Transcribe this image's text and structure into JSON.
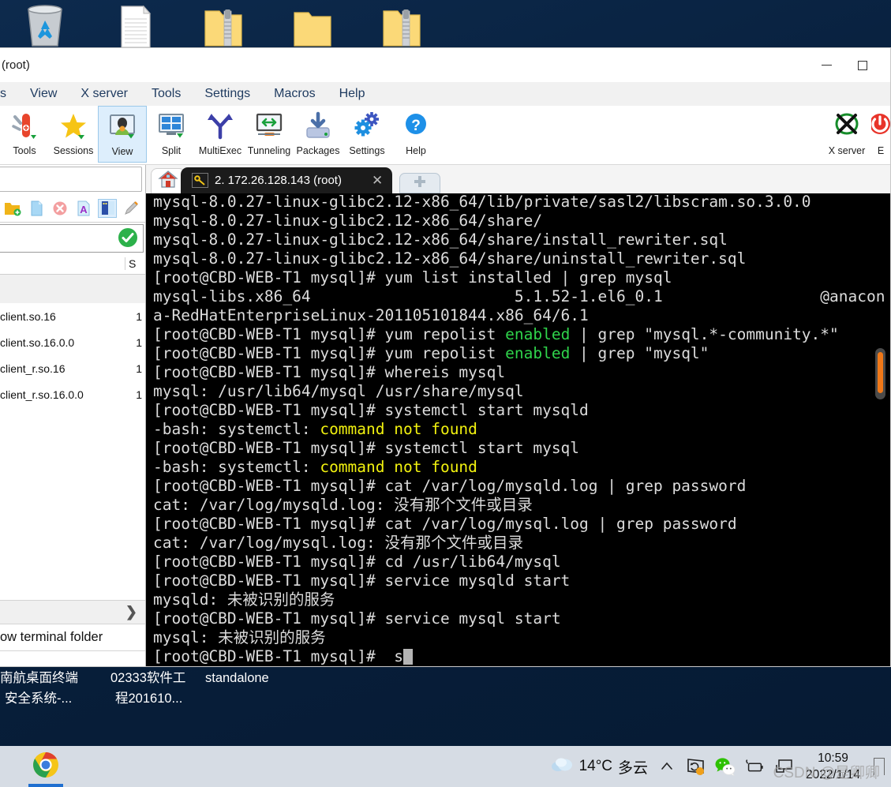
{
  "desktop": {
    "icons_top": [
      {
        "name": "recycle-bin"
      },
      {
        "name": "text-document"
      },
      {
        "name": "zip-folder-1"
      },
      {
        "name": "plain-folder"
      },
      {
        "name": "zip-folder-2"
      }
    ],
    "icon_labels": [
      {
        "line1": "南航桌面终端",
        "line2": "安全系统-..."
      },
      {
        "line1": "02333软件工",
        "line2": "程201610..."
      },
      {
        "line1": "standalone",
        "line2": ""
      }
    ]
  },
  "window": {
    "title": "(root)",
    "minimize_icon": "minimize-icon",
    "maximize_icon": "maximize-icon"
  },
  "menubar": {
    "items": [
      "s",
      "View",
      "X server",
      "Tools",
      "Settings",
      "Macros",
      "Help"
    ]
  },
  "ribbon": {
    "buttons": [
      {
        "label": "Tools",
        "icon": "swiss-knife-icon",
        "selected": false
      },
      {
        "label": "Sessions",
        "icon": "star-icon",
        "selected": false
      },
      {
        "label": "View",
        "icon": "monitor-user-icon",
        "selected": true
      },
      {
        "label": "Split",
        "icon": "split-screen-icon",
        "selected": false
      },
      {
        "label": "MultiExec",
        "icon": "branch-fork-icon",
        "selected": false
      },
      {
        "label": "Tunneling",
        "icon": "tunnel-arrows-icon",
        "selected": false
      },
      {
        "label": "Packages",
        "icon": "package-download-icon",
        "selected": false
      },
      {
        "label": "Settings",
        "icon": "gears-icon",
        "selected": false
      },
      {
        "label": "Help",
        "icon": "question-circle-icon",
        "selected": false
      }
    ],
    "right_buttons": [
      {
        "label": "X server",
        "icon": "x-server-icon"
      },
      {
        "label": "E",
        "icon": "exit-circle-icon"
      }
    ]
  },
  "sftp": {
    "toolbar_icons": [
      {
        "name": "new-folder-icon",
        "selected": false
      },
      {
        "name": "new-file-icon",
        "selected": false
      },
      {
        "name": "delete-icon",
        "selected": false
      },
      {
        "name": "rename-icon",
        "selected": false
      },
      {
        "name": "text-editor-icon",
        "selected": true
      },
      {
        "name": "edit-pencil-icon",
        "selected": false
      }
    ],
    "status_icon": "green-check-icon",
    "column_headers": {
      "name": "",
      "size": "S"
    },
    "files": [
      {
        "name": "client.so.16",
        "size": "1"
      },
      {
        "name": "client.so.16.0.0",
        "size": "1"
      },
      {
        "name": "client_r.so.16",
        "size": "1"
      },
      {
        "name": "client_r.so.16.0.0",
        "size": "1"
      }
    ],
    "expand_icon": "chevron-right-icon",
    "follow_label": "ow terminal folder"
  },
  "tabs": {
    "home_icon": "home-icon",
    "session": {
      "icon": "key-icon",
      "label": "2. 172.26.128.143 (root)",
      "close_icon": "close-icon"
    },
    "new_tab_icon": "new-tab-plus-icon"
  },
  "terminal": {
    "prompt": "[root@CBD-WEB-T1 mysql]# ",
    "lines": [
      [
        {
          "t": "mysql-8.0.27-linux-glibc2.12-x86_64/lib/private/sasl2/libscram.so.3.0.0",
          "c": "w"
        }
      ],
      [
        {
          "t": "mysql-8.0.27-linux-glibc2.12-x86_64/share/",
          "c": "w"
        }
      ],
      [
        {
          "t": "mysql-8.0.27-linux-glibc2.12-x86_64/share/install_rewriter.sql",
          "c": "w"
        }
      ],
      [
        {
          "t": "mysql-8.0.27-linux-glibc2.12-x86_64/share/uninstall_rewriter.sql",
          "c": "w"
        }
      ],
      [
        {
          "t": "[root@CBD-WEB-T1 mysql]# yum list installed | grep mysql",
          "c": "w"
        }
      ],
      [
        {
          "t": "mysql-libs.x86_64                      5.1.52-1.el6_0.1                 @anacon",
          "c": "w"
        }
      ],
      [
        {
          "t": "a-RedHatEnterpriseLinux-201105101844.x86_64/6.1",
          "c": "w"
        }
      ],
      [
        {
          "t": "[root@CBD-WEB-T1 mysql]# yum repolist ",
          "c": "w"
        },
        {
          "t": "enabled",
          "c": "g"
        },
        {
          "t": " | grep \"mysql.*-community.*\"",
          "c": "w"
        }
      ],
      [
        {
          "t": "[root@CBD-WEB-T1 mysql]# yum repolist ",
          "c": "w"
        },
        {
          "t": "enabled",
          "c": "g"
        },
        {
          "t": " | grep \"mysql\"",
          "c": "w"
        }
      ],
      [
        {
          "t": "[root@CBD-WEB-T1 mysql]# whereis mysql",
          "c": "w"
        }
      ],
      [
        {
          "t": "mysql: /usr/lib64/mysql /usr/share/mysql",
          "c": "w"
        }
      ],
      [
        {
          "t": "[root@CBD-WEB-T1 mysql]# systemctl start mysqld",
          "c": "w"
        }
      ],
      [
        {
          "t": "-bash: systemctl: ",
          "c": "w"
        },
        {
          "t": "command not found",
          "c": "y"
        }
      ],
      [
        {
          "t": "[root@CBD-WEB-T1 mysql]# systemctl start mysql",
          "c": "w"
        }
      ],
      [
        {
          "t": "-bash: systemctl: ",
          "c": "w"
        },
        {
          "t": "command not found",
          "c": "y"
        }
      ],
      [
        {
          "t": "[root@CBD-WEB-T1 mysql]# cat /var/log/mysqld.log | grep password",
          "c": "w"
        }
      ],
      [
        {
          "t": "cat: /var/log/mysqld.log: 没有那个文件或目录",
          "c": "w"
        }
      ],
      [
        {
          "t": "[root@CBD-WEB-T1 mysql]# cat /var/log/mysql.log | grep password",
          "c": "w"
        }
      ],
      [
        {
          "t": "cat: /var/log/mysql.log: 没有那个文件或目录",
          "c": "w"
        }
      ],
      [
        {
          "t": "[root@CBD-WEB-T1 mysql]# cd /usr/lib64/mysql",
          "c": "w"
        }
      ],
      [
        {
          "t": "[root@CBD-WEB-T1 mysql]# service mysqld start",
          "c": "w"
        }
      ],
      [
        {
          "t": "mysqld: 未被识别的服务",
          "c": "w"
        }
      ],
      [
        {
          "t": "[root@CBD-WEB-T1 mysql]# service mysql start",
          "c": "w"
        }
      ],
      [
        {
          "t": "mysql: 未被识别的服务",
          "c": "w"
        }
      ],
      [
        {
          "t": "[root@CBD-WEB-T1 mysql]#  s",
          "c": "w",
          "cursor": true
        }
      ]
    ],
    "colors": {
      "background": "#000000",
      "foreground": "#dcdcdc",
      "green": "#2fd34b",
      "yellow": "#f2f20f",
      "scrollbar_thumb": "#f07818"
    }
  },
  "taskbar": {
    "apps": [
      {
        "name": "chrome-icon",
        "active": true
      }
    ],
    "weather": {
      "icon": "cloud-icon",
      "temperature": "14°C",
      "condition": "多云"
    },
    "tray": [
      {
        "name": "chevron-up-icon"
      },
      {
        "name": "sync-app-icon"
      },
      {
        "name": "wechat-icon"
      },
      {
        "name": "battery-icon"
      },
      {
        "name": "network-icon"
      }
    ],
    "clock": {
      "time": "10:59",
      "date": "2022/1/14"
    },
    "show_desktop_icon": "show-desktop-icon"
  },
  "watermark": "CSDN @是卿卿"
}
